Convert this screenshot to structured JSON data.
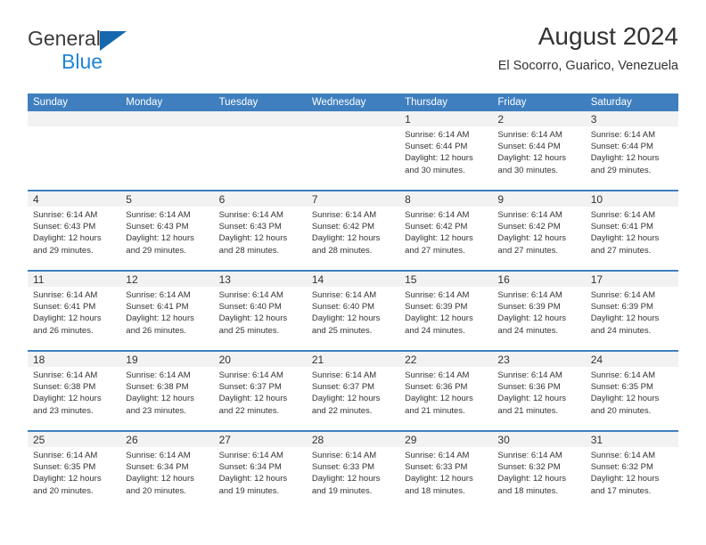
{
  "brand": {
    "name_part1": "General",
    "name_part2": "Blue",
    "triangle_color": "#1667ad",
    "blue_color": "#1e84d8"
  },
  "header": {
    "title": "August 2024",
    "subtitle": "El Socorro, Guarico, Venezuela"
  },
  "theme": {
    "header_blue": "#3f7fbf",
    "day_band_gray": "#f2f2f2",
    "text_color": "#333333"
  },
  "weekday_headers": [
    "Sunday",
    "Monday",
    "Tuesday",
    "Wednesday",
    "Thursday",
    "Friday",
    "Saturday"
  ],
  "weeks": [
    [
      {
        "day": "",
        "lines": []
      },
      {
        "day": "",
        "lines": []
      },
      {
        "day": "",
        "lines": []
      },
      {
        "day": "",
        "lines": []
      },
      {
        "day": "1",
        "lines": [
          "Sunrise: 6:14 AM",
          "Sunset: 6:44 PM",
          "Daylight: 12 hours",
          "and 30 minutes."
        ]
      },
      {
        "day": "2",
        "lines": [
          "Sunrise: 6:14 AM",
          "Sunset: 6:44 PM",
          "Daylight: 12 hours",
          "and 30 minutes."
        ]
      },
      {
        "day": "3",
        "lines": [
          "Sunrise: 6:14 AM",
          "Sunset: 6:44 PM",
          "Daylight: 12 hours",
          "and 29 minutes."
        ]
      }
    ],
    [
      {
        "day": "4",
        "lines": [
          "Sunrise: 6:14 AM",
          "Sunset: 6:43 PM",
          "Daylight: 12 hours",
          "and 29 minutes."
        ]
      },
      {
        "day": "5",
        "lines": [
          "Sunrise: 6:14 AM",
          "Sunset: 6:43 PM",
          "Daylight: 12 hours",
          "and 29 minutes."
        ]
      },
      {
        "day": "6",
        "lines": [
          "Sunrise: 6:14 AM",
          "Sunset: 6:43 PM",
          "Daylight: 12 hours",
          "and 28 minutes."
        ]
      },
      {
        "day": "7",
        "lines": [
          "Sunrise: 6:14 AM",
          "Sunset: 6:42 PM",
          "Daylight: 12 hours",
          "and 28 minutes."
        ]
      },
      {
        "day": "8",
        "lines": [
          "Sunrise: 6:14 AM",
          "Sunset: 6:42 PM",
          "Daylight: 12 hours",
          "and 27 minutes."
        ]
      },
      {
        "day": "9",
        "lines": [
          "Sunrise: 6:14 AM",
          "Sunset: 6:42 PM",
          "Daylight: 12 hours",
          "and 27 minutes."
        ]
      },
      {
        "day": "10",
        "lines": [
          "Sunrise: 6:14 AM",
          "Sunset: 6:41 PM",
          "Daylight: 12 hours",
          "and 27 minutes."
        ]
      }
    ],
    [
      {
        "day": "11",
        "lines": [
          "Sunrise: 6:14 AM",
          "Sunset: 6:41 PM",
          "Daylight: 12 hours",
          "and 26 minutes."
        ]
      },
      {
        "day": "12",
        "lines": [
          "Sunrise: 6:14 AM",
          "Sunset: 6:41 PM",
          "Daylight: 12 hours",
          "and 26 minutes."
        ]
      },
      {
        "day": "13",
        "lines": [
          "Sunrise: 6:14 AM",
          "Sunset: 6:40 PM",
          "Daylight: 12 hours",
          "and 25 minutes."
        ]
      },
      {
        "day": "14",
        "lines": [
          "Sunrise: 6:14 AM",
          "Sunset: 6:40 PM",
          "Daylight: 12 hours",
          "and 25 minutes."
        ]
      },
      {
        "day": "15",
        "lines": [
          "Sunrise: 6:14 AM",
          "Sunset: 6:39 PM",
          "Daylight: 12 hours",
          "and 24 minutes."
        ]
      },
      {
        "day": "16",
        "lines": [
          "Sunrise: 6:14 AM",
          "Sunset: 6:39 PM",
          "Daylight: 12 hours",
          "and 24 minutes."
        ]
      },
      {
        "day": "17",
        "lines": [
          "Sunrise: 6:14 AM",
          "Sunset: 6:39 PM",
          "Daylight: 12 hours",
          "and 24 minutes."
        ]
      }
    ],
    [
      {
        "day": "18",
        "lines": [
          "Sunrise: 6:14 AM",
          "Sunset: 6:38 PM",
          "Daylight: 12 hours",
          "and 23 minutes."
        ]
      },
      {
        "day": "19",
        "lines": [
          "Sunrise: 6:14 AM",
          "Sunset: 6:38 PM",
          "Daylight: 12 hours",
          "and 23 minutes."
        ]
      },
      {
        "day": "20",
        "lines": [
          "Sunrise: 6:14 AM",
          "Sunset: 6:37 PM",
          "Daylight: 12 hours",
          "and 22 minutes."
        ]
      },
      {
        "day": "21",
        "lines": [
          "Sunrise: 6:14 AM",
          "Sunset: 6:37 PM",
          "Daylight: 12 hours",
          "and 22 minutes."
        ]
      },
      {
        "day": "22",
        "lines": [
          "Sunrise: 6:14 AM",
          "Sunset: 6:36 PM",
          "Daylight: 12 hours",
          "and 21 minutes."
        ]
      },
      {
        "day": "23",
        "lines": [
          "Sunrise: 6:14 AM",
          "Sunset: 6:36 PM",
          "Daylight: 12 hours",
          "and 21 minutes."
        ]
      },
      {
        "day": "24",
        "lines": [
          "Sunrise: 6:14 AM",
          "Sunset: 6:35 PM",
          "Daylight: 12 hours",
          "and 20 minutes."
        ]
      }
    ],
    [
      {
        "day": "25",
        "lines": [
          "Sunrise: 6:14 AM",
          "Sunset: 6:35 PM",
          "Daylight: 12 hours",
          "and 20 minutes."
        ]
      },
      {
        "day": "26",
        "lines": [
          "Sunrise: 6:14 AM",
          "Sunset: 6:34 PM",
          "Daylight: 12 hours",
          "and 20 minutes."
        ]
      },
      {
        "day": "27",
        "lines": [
          "Sunrise: 6:14 AM",
          "Sunset: 6:34 PM",
          "Daylight: 12 hours",
          "and 19 minutes."
        ]
      },
      {
        "day": "28",
        "lines": [
          "Sunrise: 6:14 AM",
          "Sunset: 6:33 PM",
          "Daylight: 12 hours",
          "and 19 minutes."
        ]
      },
      {
        "day": "29",
        "lines": [
          "Sunrise: 6:14 AM",
          "Sunset: 6:33 PM",
          "Daylight: 12 hours",
          "and 18 minutes."
        ]
      },
      {
        "day": "30",
        "lines": [
          "Sunrise: 6:14 AM",
          "Sunset: 6:32 PM",
          "Daylight: 12 hours",
          "and 18 minutes."
        ]
      },
      {
        "day": "31",
        "lines": [
          "Sunrise: 6:14 AM",
          "Sunset: 6:32 PM",
          "Daylight: 12 hours",
          "and 17 minutes."
        ]
      }
    ]
  ]
}
